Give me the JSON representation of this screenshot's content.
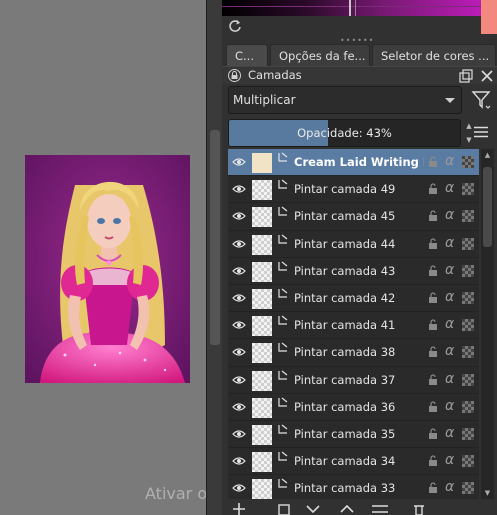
{
  "watermark": "Ativar o Windows",
  "tabs": [
    {
      "label": "C..."
    },
    {
      "label": "Opções da fe..."
    },
    {
      "label": "Seletor de cores ..."
    }
  ],
  "panel": {
    "title": "Camadas",
    "blend_mode": "Multiplicar",
    "opacity_label": "Opacidade:  43%",
    "opacity_value": 43
  },
  "layers": [
    {
      "name": "Cream Laid Writing Pa...",
      "selected": true,
      "thumb": "solid"
    },
    {
      "name": "Pintar camada 49",
      "selected": false,
      "thumb": "checker"
    },
    {
      "name": "Pintar camada 45",
      "selected": false,
      "thumb": "checker"
    },
    {
      "name": "Pintar camada 44",
      "selected": false,
      "thumb": "checker"
    },
    {
      "name": "Pintar camada 43",
      "selected": false,
      "thumb": "checker"
    },
    {
      "name": "Pintar camada 42",
      "selected": false,
      "thumb": "checker"
    },
    {
      "name": "Pintar camada 41",
      "selected": false,
      "thumb": "checker"
    },
    {
      "name": "Pintar camada 38",
      "selected": false,
      "thumb": "checker"
    },
    {
      "name": "Pintar camada 37",
      "selected": false,
      "thumb": "checker"
    },
    {
      "name": "Pintar camada 36",
      "selected": false,
      "thumb": "checker"
    },
    {
      "name": "Pintar camada 35",
      "selected": false,
      "thumb": "checker"
    },
    {
      "name": "Pintar camada 34",
      "selected": false,
      "thumb": "checker"
    },
    {
      "name": "Pintar camada 33",
      "selected": false,
      "thumb": "checker"
    }
  ],
  "colors": {
    "accent": "#5a7ca3",
    "opacity_fill": "#587a9e",
    "swatch": "#f3887f"
  }
}
